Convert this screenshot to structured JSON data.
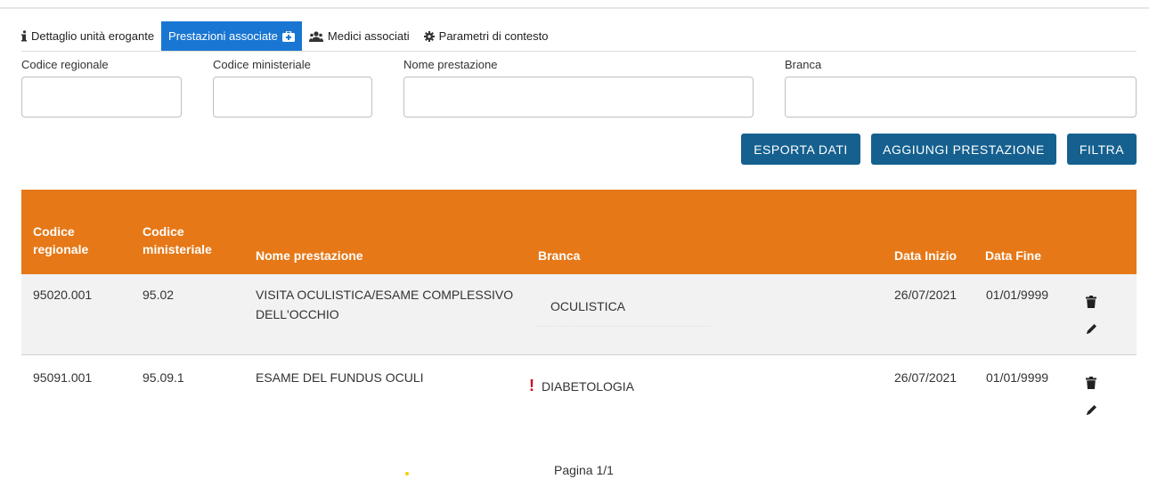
{
  "tabs": [
    {
      "label": "Dettaglio unità erogante",
      "icon": "info-icon",
      "active": false
    },
    {
      "label": "Prestazioni associate",
      "icon": "medical-kit-icon",
      "active": true
    },
    {
      "label": "Medici associati",
      "icon": "users-icon",
      "active": false
    },
    {
      "label": "Parametri di contesto",
      "icon": "gear-icon",
      "active": false
    }
  ],
  "filters": {
    "codice_regionale": {
      "label": "Codice regionale",
      "value": ""
    },
    "codice_ministeriale": {
      "label": "Codice ministeriale",
      "value": ""
    },
    "nome_prestazione": {
      "label": "Nome prestazione",
      "value": ""
    },
    "branca": {
      "label": "Branca",
      "value": ""
    }
  },
  "buttons": {
    "esporta": "ESPORTA DATI",
    "aggiungi": "AGGIUNGI PRESTAZIONE",
    "filtra": "FILTRA"
  },
  "table": {
    "headers": {
      "codice_regionale": "Codice regionale",
      "codice_ministeriale": "Codice ministeriale",
      "nome_prestazione": "Nome prestazione",
      "branca": "Branca",
      "data_inizio": "Data Inizio",
      "data_fine": "Data Fine"
    },
    "rows": [
      {
        "codice_regionale": "95020.001",
        "codice_ministeriale": "95.02",
        "nome_prestazione": "VISITA OCULISTICA/ESAME COMPLESSIVO DELL'OCCHIO",
        "branca": "OCULISTICA",
        "warning": "",
        "data_inizio": "26/07/2021",
        "data_fine": "01/01/9999"
      },
      {
        "codice_regionale": "95091.001",
        "codice_ministeriale": "95.09.1",
        "nome_prestazione": "ESAME DEL FUNDUS OCULI",
        "branca": "DIABETOLOGIA",
        "warning": "!",
        "data_inizio": "26/07/2021",
        "data_fine": "01/01/9999"
      }
    ]
  },
  "pagination": {
    "label": "Pagina 1/1"
  },
  "colors": {
    "tab_active": "#1976d2",
    "button": "#15608f",
    "table_header": "#e67817",
    "warning": "#d0021b"
  }
}
